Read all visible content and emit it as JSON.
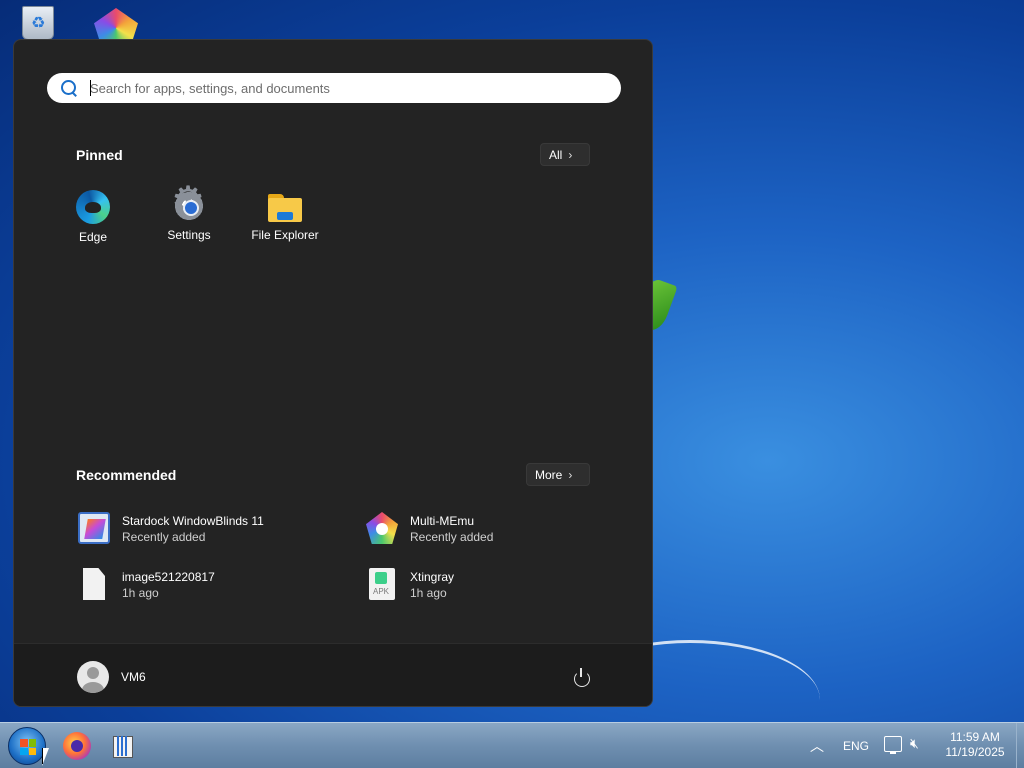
{
  "search": {
    "placeholder": "Search for apps, settings, and documents"
  },
  "pinned": {
    "title": "Pinned",
    "all_label": "All",
    "apps": [
      {
        "label": "Edge",
        "icon": "edge-icon"
      },
      {
        "label": "Settings",
        "icon": "settings-gear-icon"
      },
      {
        "label": "File Explorer",
        "icon": "folder-icon"
      }
    ]
  },
  "recommended": {
    "title": "Recommended",
    "more_label": "More",
    "items": [
      {
        "name": "Stardock WindowBlinds 11",
        "sub": "Recently added",
        "icon": "windowblinds-icon"
      },
      {
        "name": "Multi-MEmu",
        "sub": "Recently added",
        "icon": "memu-icon"
      },
      {
        "name": "image521220817",
        "sub": "1h ago",
        "icon": "file-icon"
      },
      {
        "name": "Xtingray",
        "sub": "1h ago",
        "icon": "apk-file-icon"
      }
    ]
  },
  "user": {
    "name": "VM6"
  },
  "taskbar": {
    "language": "ENG",
    "time": "11:59 AM",
    "date": "11/19/2025"
  }
}
